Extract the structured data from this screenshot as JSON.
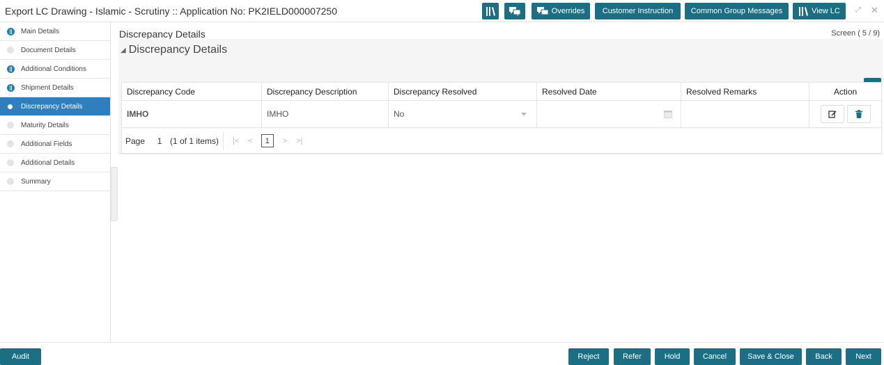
{
  "header": {
    "title": "Export LC Drawing - Islamic - Scrutiny :: Application No: PK2IELD000007250",
    "buttons": {
      "overrides": "Overrides",
      "customer_instruction": "Customer Instruction",
      "common_group_messages": "Common Group Messages",
      "view_lc": "View LC"
    },
    "icons": [
      "library-icon",
      "chat-icon",
      "overrides-chat-icon",
      "library-icon",
      "expand-icon",
      "close-icon"
    ]
  },
  "sidebar": {
    "items": [
      {
        "label": "Main Details",
        "status": "partial"
      },
      {
        "label": "Document Details",
        "status": "none"
      },
      {
        "label": "Additional Conditions",
        "status": "partial"
      },
      {
        "label": "Shipment Details",
        "status": "partial"
      },
      {
        "label": "Discrepancy Details",
        "status": "active"
      },
      {
        "label": "Maturity Details",
        "status": "none"
      },
      {
        "label": "Additional Fields",
        "status": "none"
      },
      {
        "label": "Additional Details",
        "status": "none"
      },
      {
        "label": "Summary",
        "status": "none"
      }
    ]
  },
  "main": {
    "title": "Discrepancy Details",
    "screen_indicator": "Screen ( 5 / 9)",
    "section_title": "Discrepancy Details",
    "table": {
      "columns": [
        "Discrepancy Code",
        "Discrepancy Description",
        "Discrepancy Resolved",
        "Resolved Date",
        "Resolved Remarks",
        "Action"
      ],
      "rows": [
        {
          "code": "IMHO",
          "description": "IMHO",
          "resolved": "No",
          "date": "",
          "remarks": ""
        }
      ]
    },
    "pager": {
      "label": "Page",
      "page": "1",
      "info": "(1 of 1 items)",
      "current": "1"
    }
  },
  "footer": {
    "audit": "Audit",
    "reject": "Reject",
    "refer": "Refer",
    "hold": "Hold",
    "cancel": "Cancel",
    "save_close": "Save & Close",
    "back": "Back",
    "next": "Next"
  },
  "colors": {
    "accent": "#1a6f84",
    "active_nav": "#2f7fbf",
    "status_partial": "#1a7fc1"
  }
}
